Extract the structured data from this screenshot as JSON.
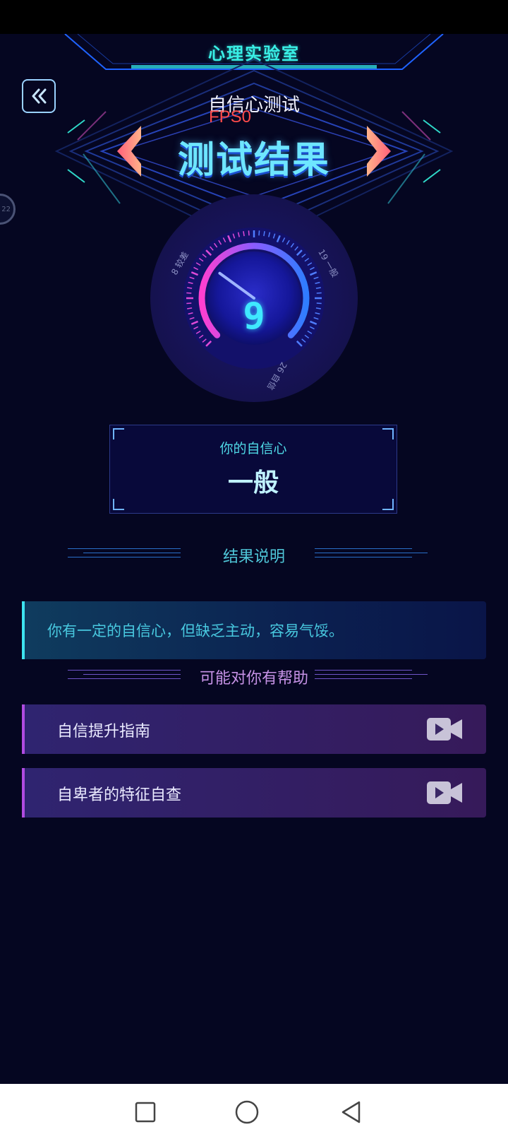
{
  "app_title": "心理实验室",
  "subtitle": "自信心测试",
  "fps_label": "FPS0",
  "result_title": "测试结果",
  "side_float_label": "22",
  "gauge": {
    "score": "9",
    "scale_labels": [
      "8 较差",
      "19 一般",
      "26 自信"
    ],
    "score_fraction": 0.3
  },
  "result_box": {
    "label": "你的自信心",
    "value": "一般"
  },
  "explanation": {
    "heading": "结果说明",
    "text": "你有一定的自信心，但缺乏主动，容易气馁。"
  },
  "help": {
    "heading": "可能对你有帮助",
    "items": [
      {
        "label": "自信提升指南",
        "icon": "video-icon"
      },
      {
        "label": "自卑者的特征自查",
        "icon": "video-icon"
      }
    ]
  },
  "colors": {
    "background": "#050621",
    "accent_cyan": "#39f0e6",
    "accent_purple": "#b04be0",
    "fps_red": "#ff4b4b"
  }
}
